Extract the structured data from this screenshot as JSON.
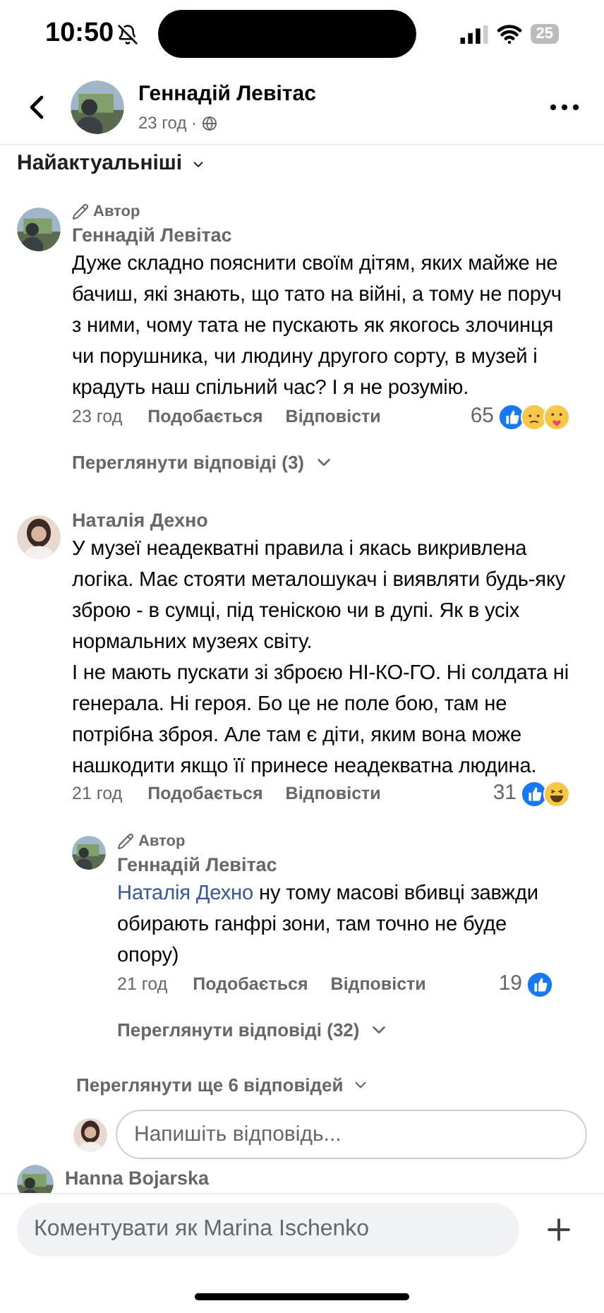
{
  "status_bar": {
    "time": "10:50",
    "battery": "25"
  },
  "header": {
    "name": "Геннадій Левітас",
    "time": "23 год ·"
  },
  "sort": {
    "label": "Найактуальніші"
  },
  "comments": [
    {
      "badge": "Автор",
      "name": "Геннадій Левітас",
      "text": "Дуже складно пояснити своїм дітям, яких майже не бачиш, які знають, що тато на війні, а тому не поруч з ними, чому тата не пускають як якогось злочинця чи порушника, чи людину другого сорту, в музей і крадуть наш спільний час? І я не розумію.",
      "time": "23 год",
      "like": "Подобається",
      "reply": "Відповісти",
      "count": "65",
      "reactions": [
        {
          "kind": "like"
        },
        {
          "kind": "sad"
        },
        {
          "kind": "care"
        }
      ],
      "view_replies": "Переглянути відповіді (3)"
    },
    {
      "name": "Наталія Дехно",
      "text": "У музеї неадекватні правила і якась викривлена логіка. Має стояти металошукач і виявляти будь-яку зброю - в сумці, під теніскою чи в дупі. Як в усіх нормальних музеях світу.\nІ не мають пускати зі зброєю НІ-КО-ГО. Ні солдата ні генерала. Ні героя. Бо це не поле бою, там не потрібна зброя. Але там є діти, яким вона може нашкодити якщо її принесе неадекватна людина.",
      "time": "21 год",
      "like": "Подобається",
      "reply": "Відповісти",
      "count": "31",
      "reactions": [
        {
          "kind": "like"
        },
        {
          "kind": "haha"
        }
      ],
      "replies": [
        {
          "badge": "Автор",
          "name": "Геннадій Левітас",
          "mention": "Наталія Дехно",
          "text": "ну тому масові вбивці завжди обирають ганфрі зони, там точно не буде опору)",
          "time": "21 год",
          "like": "Подобається",
          "reply": "Відповісти",
          "count": "19",
          "reactions": [
            {
              "kind": "like"
            }
          ],
          "view_replies": "Переглянути відповіді (32)"
        }
      ]
    }
  ],
  "more_replies": "Переглянути ще 6 відповідей",
  "reply_field": {
    "placeholder": "Напишіть відповідь..."
  },
  "next_comment": {
    "name": "Hanna Bojarska"
  },
  "composer": {
    "placeholder": "Коментувати як Marina Ischenko"
  }
}
